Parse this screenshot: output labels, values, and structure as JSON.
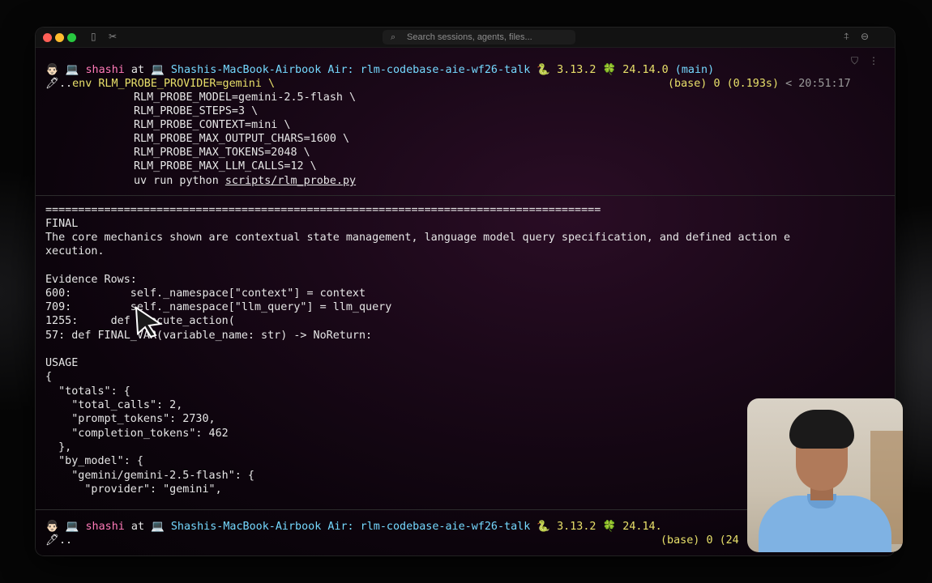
{
  "app": {
    "search_placeholder": "Search sessions, agents, files..."
  },
  "prompt": {
    "emoji_left": "👨🏻 💻",
    "user": "shashi",
    "at": "at",
    "host_prefix": "💻",
    "host": "Shashis-MacBook-Airbook Air:",
    "dir": "rlm-codebase-aie-wf26-talk",
    "py_icon": "🐍",
    "py_version": "3.13.2",
    "node_icon": "🍀",
    "node_version": "24.14.0",
    "branch": "(main)",
    "status_env": "(base)",
    "status_code": "0",
    "status_time": "(0.193s)",
    "status_clock": "< 20:51:17"
  },
  "command": {
    "lead": "🖊..",
    "first": "env RLM_PROBE_PROVIDER=gemini \\",
    "args": [
      "RLM_PROBE_MODEL=gemini-2.5-flash \\",
      "RLM_PROBE_STEPS=3 \\",
      "RLM_PROBE_CONTEXT=mini \\",
      "RLM_PROBE_MAX_OUTPUT_CHARS=1600 \\",
      "RLM_PROBE_MAX_TOKENS=2048 \\",
      "RLM_PROBE_MAX_LLM_CALLS=12 \\"
    ],
    "run_prefix": "uv run python ",
    "script": "scripts/rlm_probe.py"
  },
  "output": {
    "separator": "=====================================================================================",
    "final_label": "FINAL",
    "final_text_1": "The core mechanics shown are contextual state management, language model query specification, and defined action e",
    "final_text_2": "xecution.",
    "evidence_label": "Evidence Rows:",
    "evidence": [
      "600:         self._namespace[\"context\"] = context",
      "709:         self._namespace[\"llm_query\"] = llm_query",
      "1255:     def execute_action(",
      "57: def FINAL_VAR(variable_name: str) -> NoReturn:"
    ],
    "usage_label": "USAGE",
    "usage_json": [
      "{",
      "  \"totals\": {",
      "    \"total_calls\": 2,",
      "    \"prompt_tokens\": 2730,",
      "    \"completion_tokens\": 462",
      "  },",
      "  \"by_model\": {",
      "    \"gemini/gemini-2.5-flash\": {",
      "      \"provider\": \"gemini\","
    ]
  },
  "prompt2": {
    "node_version_cut": "24.14.",
    "status_env": "(base)",
    "status_code": "0",
    "status_time_cut": "(24",
    "lead": "🖊.."
  },
  "colors": {
    "user": "#ff7ab8",
    "host": "#75d9ff",
    "dir": "#75d9ff",
    "version": "#e8e06a",
    "status": "#e8e06a"
  }
}
